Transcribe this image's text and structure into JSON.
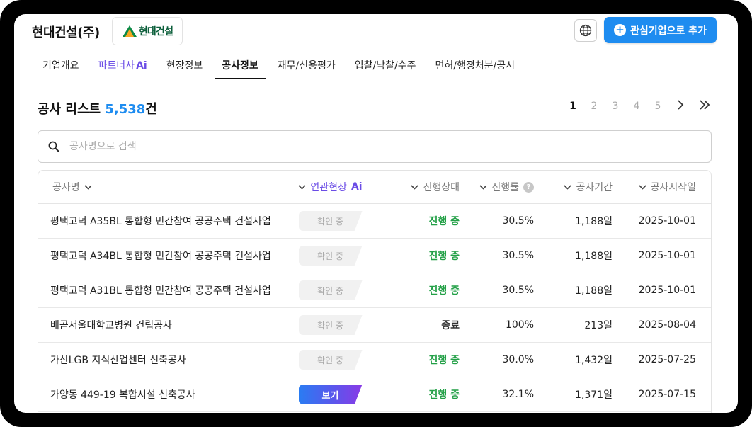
{
  "header": {
    "company_title": "현대건설(주)",
    "logo_text": "현대건설",
    "add_button_label": "관심기업으로 추가",
    "globe_icon": "globe-icon"
  },
  "tabs": [
    {
      "label": "기업개요"
    },
    {
      "label": "파트너사",
      "suffix": "Ai"
    },
    {
      "label": "현장정보"
    },
    {
      "label": "공사정보",
      "active": true
    },
    {
      "label": "재무/신용평가"
    },
    {
      "label": "입찰/낙찰/수주"
    },
    {
      "label": "면허/행정처분/공시"
    }
  ],
  "list": {
    "title": "공사 리스트",
    "count": "5,538",
    "count_suffix": "건"
  },
  "pagination": {
    "pages": [
      "1",
      "2",
      "3",
      "4",
      "5"
    ],
    "current": "1",
    "next": "›",
    "last": "»"
  },
  "search": {
    "placeholder": "공사명으로 검색",
    "value": ""
  },
  "table": {
    "headers": {
      "name": "공사명",
      "related": "연관현장",
      "related_suffix": "Ai",
      "status": "진행상태",
      "rate": "진행률",
      "help": "?",
      "period": "공사기간",
      "start": "공사시작일"
    },
    "rows": [
      {
        "name": "평택고덕 A35BL 통합형 민간참여 공공주택 건설사업",
        "related": "확인 중",
        "related_type": "check",
        "status": "진행 중",
        "status_type": "ongoing",
        "rate": "30.5%",
        "period": "1,188일",
        "start": "2025-10-01"
      },
      {
        "name": "평택고덕 A34BL 통합형 민간참여 공공주택 건설사업",
        "related": "확인 중",
        "related_type": "check",
        "status": "진행 중",
        "status_type": "ongoing",
        "rate": "30.5%",
        "period": "1,188일",
        "start": "2025-10-01"
      },
      {
        "name": "평택고덕 A31BL 통합형 민간참여 공공주택 건설사업",
        "related": "확인 중",
        "related_type": "check",
        "status": "진행 중",
        "status_type": "ongoing",
        "rate": "30.5%",
        "period": "1,188일",
        "start": "2025-10-01"
      },
      {
        "name": "배곧서울대학교병원 건립공사",
        "related": "확인 중",
        "related_type": "check",
        "status": "종료",
        "status_type": "done",
        "rate": "100%",
        "period": "213일",
        "start": "2025-08-04"
      },
      {
        "name": "가산LGB 지식산업센터 신축공사",
        "related": "확인 중",
        "related_type": "check",
        "status": "진행 중",
        "status_type": "ongoing",
        "rate": "30.0%",
        "period": "1,432일",
        "start": "2025-07-25"
      },
      {
        "name": "가양동 449-19 복합시설 신축공사",
        "related": "보기",
        "related_type": "view",
        "status": "진행 중",
        "status_type": "ongoing",
        "rate": "32.1%",
        "period": "1,371일",
        "start": "2025-07-15"
      },
      {
        "name": "",
        "related": "",
        "related_type": "none",
        "status": "",
        "status_type": "ongoing",
        "rate": "",
        "period": "",
        "start": ""
      }
    ]
  },
  "colors": {
    "accent": "#1e8cf0",
    "ai_purple": "#6b4ce6",
    "status_ongoing": "#23a047"
  }
}
